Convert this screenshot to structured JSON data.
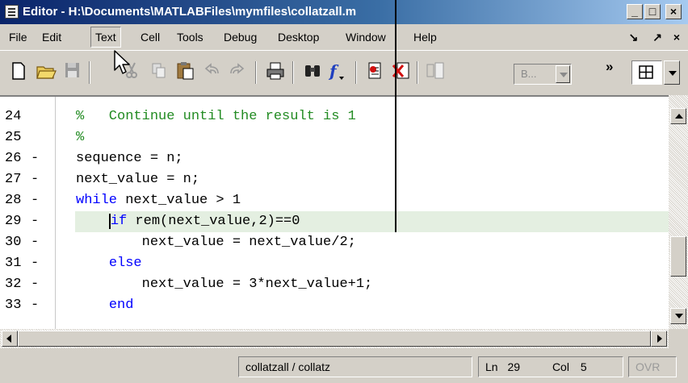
{
  "window": {
    "title": "Editor - H:\\Documents\\MATLABFiles\\mymfiles\\collatzall.m",
    "buttons": [
      "_",
      "□",
      "×"
    ]
  },
  "menu": {
    "items": [
      "File",
      "Edit",
      "Text",
      "Cell",
      "Tools",
      "Debug",
      "Desktop",
      "Window",
      "Help"
    ],
    "active": "Text",
    "right_controls": [
      "↘",
      "↗",
      "×"
    ]
  },
  "toolbar": {
    "cell_combo_value": "B...",
    "overflow_label": "»"
  },
  "editor": {
    "lines": [
      {
        "number": "24",
        "dash": "",
        "code": "%   Continue until the result is 1",
        "kind": "comment"
      },
      {
        "number": "25",
        "dash": "",
        "code": "%",
        "kind": "comment"
      },
      {
        "number": "26",
        "dash": "-",
        "code": "sequence = n;",
        "kind": "code"
      },
      {
        "number": "27",
        "dash": "-",
        "code": "next_value = n;",
        "kind": "code"
      },
      {
        "number": "28",
        "dash": "-",
        "code": "while next_value > 1",
        "kind": "while"
      },
      {
        "number": "29",
        "dash": "-",
        "code": "    if rem(next_value,2)==0",
        "kind": "if"
      },
      {
        "number": "30",
        "dash": "-",
        "code": "        next_value = next_value/2;",
        "kind": "code"
      },
      {
        "number": "31",
        "dash": "-",
        "code": "    else",
        "kind": "else"
      },
      {
        "number": "32",
        "dash": "-",
        "code": "        next_value = 3*next_value+1;",
        "kind": "code"
      },
      {
        "number": "33",
        "dash": "-",
        "code": "    end",
        "kind": "end"
      }
    ],
    "highlighted_line": "29",
    "colors": {
      "comment": "#228b22",
      "keyword": "#0000ff",
      "highlight": "#e4efe1"
    }
  },
  "statusbar": {
    "function": "collatzall / collatz",
    "line_label": "Ln",
    "line_value": "29",
    "col_label": "Col",
    "col_value": "5",
    "ovr": "OVR"
  }
}
